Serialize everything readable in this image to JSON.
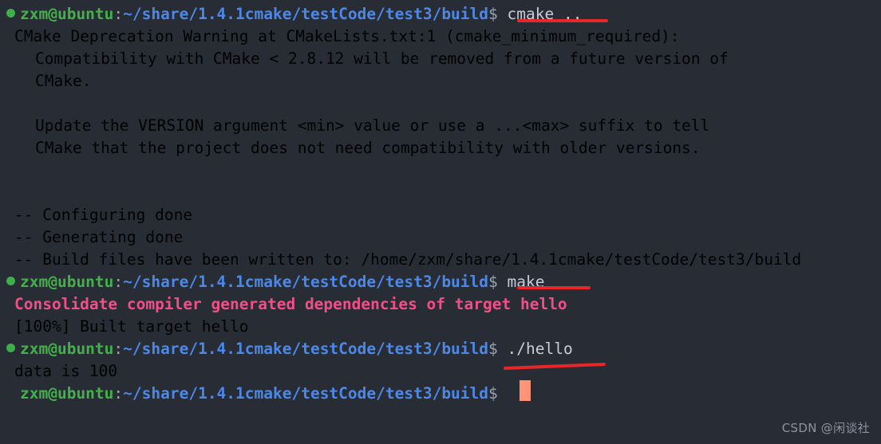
{
  "terminal": {
    "background_color": "#282c35",
    "prompt": {
      "user_host": "zxm@ubuntu",
      "separator": ":",
      "path": "~/share/1.4.1cmake/testCode/test3/build",
      "symbol": "$",
      "user_color": "#43b04a",
      "path_color": "#4b88e8",
      "dot_color": "#3fae4b"
    },
    "cursor": {
      "color": "#ff9478",
      "shape": "block"
    },
    "annotation_color": "#e8262a",
    "commands": {
      "cmake": "cmake ..",
      "make": "make",
      "hello": "./hello"
    },
    "lines": [
      {
        "id": "prompt-cmake",
        "type": "prompt",
        "command": "cmake .."
      },
      {
        "id": "out-1",
        "type": "output",
        "indent": 2,
        "text": "CMake Deprecation Warning at CMakeLists.txt:1 (cmake_minimum_required):"
      },
      {
        "id": "out-2",
        "type": "output",
        "indent": 4,
        "text": "Compatibility with CMake < 2.8.12 will be removed from a future version of"
      },
      {
        "id": "out-3",
        "type": "output",
        "indent": 4,
        "text": "CMake."
      },
      {
        "id": "out-4",
        "type": "blank",
        "indent": 4,
        "text": ""
      },
      {
        "id": "out-5",
        "type": "output",
        "indent": 4,
        "text": "Update the VERSION argument <min> value or use a ...<max> suffix to tell"
      },
      {
        "id": "out-6",
        "type": "output",
        "indent": 4,
        "text": "CMake that the project does not need compatibility with older versions."
      },
      {
        "id": "out-7",
        "type": "blank",
        "indent": 2,
        "text": ""
      },
      {
        "id": "out-8",
        "type": "blank",
        "indent": 2,
        "text": ""
      },
      {
        "id": "out-9",
        "type": "output",
        "indent": 2,
        "text": "-- Configuring done"
      },
      {
        "id": "out-10",
        "type": "output",
        "indent": 2,
        "text": "-- Generating done"
      },
      {
        "id": "out-11",
        "type": "output",
        "indent": 2,
        "text": "-- Build files have been written to: /home/zxm/share/1.4.1cmake/testCode/test3/build"
      },
      {
        "id": "prompt-make",
        "type": "prompt",
        "command": "make"
      },
      {
        "id": "out-12",
        "type": "output-pink",
        "indent": 2,
        "text": "Consolidate compiler generated dependencies of target hello"
      },
      {
        "id": "out-13",
        "type": "output",
        "indent": 2,
        "text": "[100%] Built target hello"
      },
      {
        "id": "prompt-hello",
        "type": "prompt",
        "command": "./hello"
      },
      {
        "id": "out-14",
        "type": "output",
        "indent": 2,
        "text": "data is 100"
      },
      {
        "id": "prompt-final",
        "type": "prompt-nodot",
        "command": ""
      }
    ]
  },
  "watermark": {
    "text": "CSDN @闲谈社"
  }
}
